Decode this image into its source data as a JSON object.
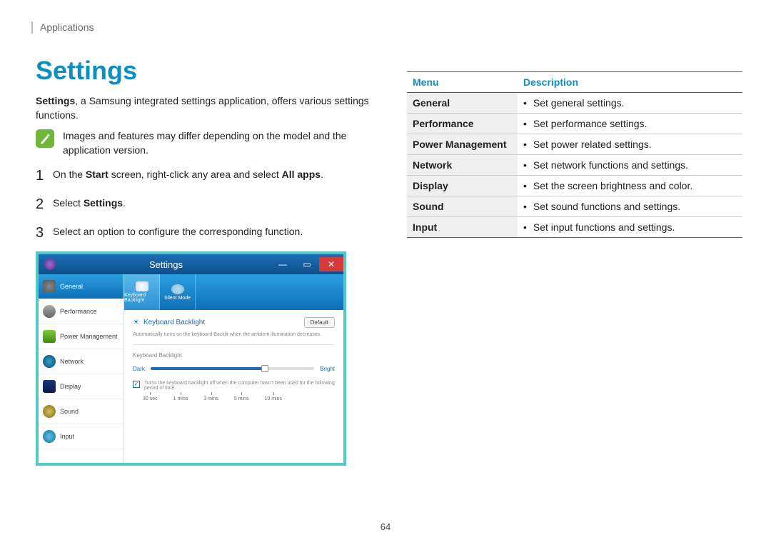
{
  "breadcrumb": "Applications",
  "title": "Settings",
  "intro_bold": "Settings",
  "intro_rest": ", a Samsung integrated settings application, offers various settings functions.",
  "note": "Images and features may differ depending on the model and the application version.",
  "steps": {
    "s1_a": "On the ",
    "s1_b": "Start",
    "s1_c": " screen, right-click any area and select ",
    "s1_d": "All apps",
    "s1_e": ".",
    "s2_a": "Select ",
    "s2_b": "Settings",
    "s2_c": ".",
    "s3": "Select an option to configure the corresponding function."
  },
  "fig": {
    "title": "Settings",
    "sidebar": {
      "general": "General",
      "performance": "Performance",
      "power": "Power Management",
      "network": "Network",
      "display": "Display",
      "sound": "Sound",
      "input": "Input"
    },
    "tabs": {
      "keyboard": "Keyboard Backlight",
      "silent": "Silent Mode"
    },
    "panel": {
      "title": "Keyboard Backlight",
      "default_btn": "Default",
      "desc": "Automatically turns on the keyboard Backlit when the ambient illumination decreases.",
      "section": "Keyboard Backlight",
      "dark": "Dark",
      "bright": "Bright",
      "chk_label": "Turns the keyboard backlight off when the computer hasn't been used for the following period of time.",
      "ticks": {
        "t1": "30 sec",
        "t2": "1 mins",
        "t3": "3 mins",
        "t4": "5 mins",
        "t5": "10 mins"
      }
    }
  },
  "table": {
    "header_menu": "Menu",
    "header_desc": "Description",
    "rows": [
      {
        "menu": "General",
        "desc": "Set general settings."
      },
      {
        "menu": "Performance",
        "desc": "Set performance settings."
      },
      {
        "menu": "Power Management",
        "desc": "Set power related settings."
      },
      {
        "menu": "Network",
        "desc": "Set network functions and settings."
      },
      {
        "menu": "Display",
        "desc": "Set the screen brightness and color."
      },
      {
        "menu": "Sound",
        "desc": "Set sound functions and settings."
      },
      {
        "menu": "Input",
        "desc": "Set input functions and settings."
      }
    ]
  },
  "page_number": "64"
}
